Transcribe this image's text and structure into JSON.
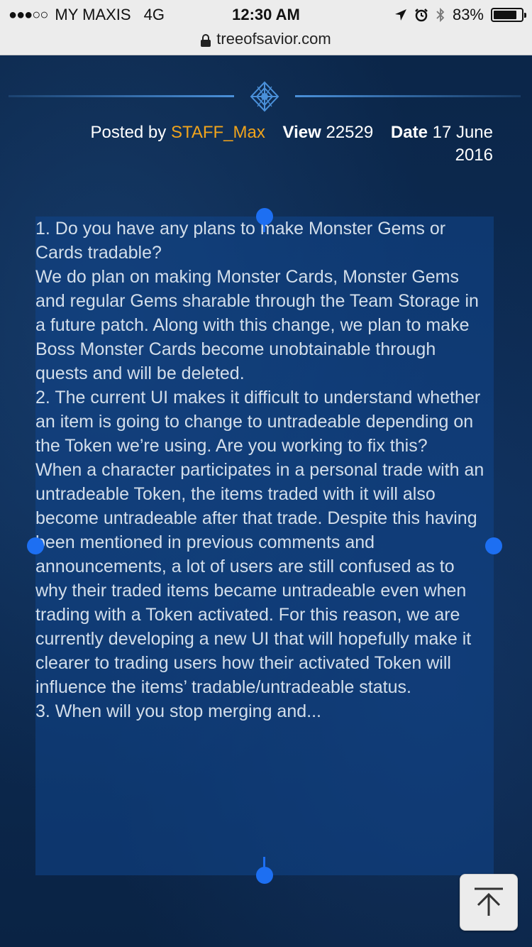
{
  "status_bar": {
    "signal_dots": "●●●○○",
    "carrier": "MY MAXIS",
    "network": "4G",
    "time": "12:30 AM",
    "battery_percent": "83%",
    "battery_level": 0.83
  },
  "url_bar": {
    "domain": "treeofsavior.com"
  },
  "post_meta": {
    "posted_by_label": "Posted by",
    "author": "STAFF_Max",
    "view_label": "View",
    "view_count": "22529",
    "date_label": "Date",
    "date_value_part1": "17 June",
    "date_value_part2": "2016"
  },
  "content": {
    "q1": "1. Do you have any plans to make Monster Gems or Cards tradable?",
    "a1": "We do plan on making Monster Cards, Monster Gems and regular Gems sharable through the Team Storage in a future patch. Along with this change, we plan to make Boss Monster Cards become unobtainable through quests and will be deleted.",
    "q2": "2. The current UI makes it difficult to understand whether an item is going to change to untradeable depending on the Token we’re using. Are you working to fix this?",
    "a2": "When a character participates in a personal trade with an untradeable Token, the items traded with it will also become untradeable after that trade. Despite this having been mentioned in previous comments and announcements, a lot of users are still confused as to why their traded items became untradeable even when trading with a Token activated. For this reason, we are currently developing a new UI that will hopefully make it clearer to trading users how their activated Token will influence the items’ tradable/untradeable status.",
    "q3_partial": "3. When will you stop merging and..."
  },
  "icons": {
    "location": "location-arrow-icon",
    "alarm": "alarm-clock-icon",
    "bluetooth": "bluetooth-icon",
    "lock": "lock-icon",
    "emblem": "emblem-icon",
    "back_to_top": "arrow-up-to-top-icon"
  },
  "colors": {
    "author": "#f0a41c",
    "accent_line": "#4a90d9",
    "selection_handle": "#1d6ff2",
    "body_text": "#d3deea"
  }
}
